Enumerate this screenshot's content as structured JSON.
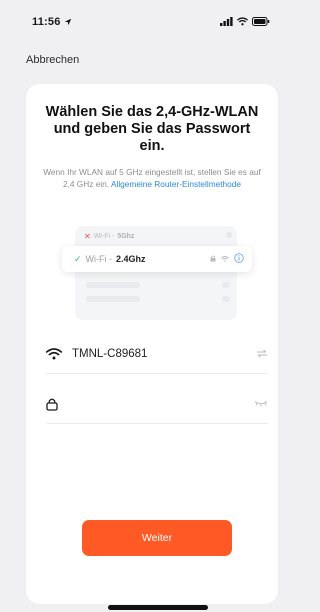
{
  "status": {
    "time": "11:56"
  },
  "nav": {
    "cancel_label": "Abbrechen"
  },
  "main": {
    "title": "Wählen Sie das 2,4-GHz-WLAN und geben Sie das Passwort ein.",
    "hint_text": "Wenn Ihr WLAN auf 5 GHz eingestellt ist, stellen Sie es auf 2,4 GHz ein.",
    "hint_link": "Allgemeine Router-Einstellmethode"
  },
  "illustration": {
    "bad_prefix": "Wi-Fi - ",
    "bad_band": "5Ghz",
    "good_prefix": "Wi-Fi - ",
    "good_band": "2.4Ghz"
  },
  "wifi": {
    "ssid": "TMNL-C89681"
  },
  "password": {
    "value": ""
  },
  "actions": {
    "next_label": "Weiter"
  },
  "colors": {
    "accent": "#ff5a26",
    "link": "#2d87e6",
    "check": "#3bb273",
    "error": "#e5534b"
  },
  "icons": [
    "location-arrow-icon",
    "signal-icon",
    "wifi-icon",
    "battery-icon",
    "x-icon",
    "check-icon",
    "lock-icon",
    "info-icon",
    "swap-icon",
    "eye-closed-icon"
  ]
}
